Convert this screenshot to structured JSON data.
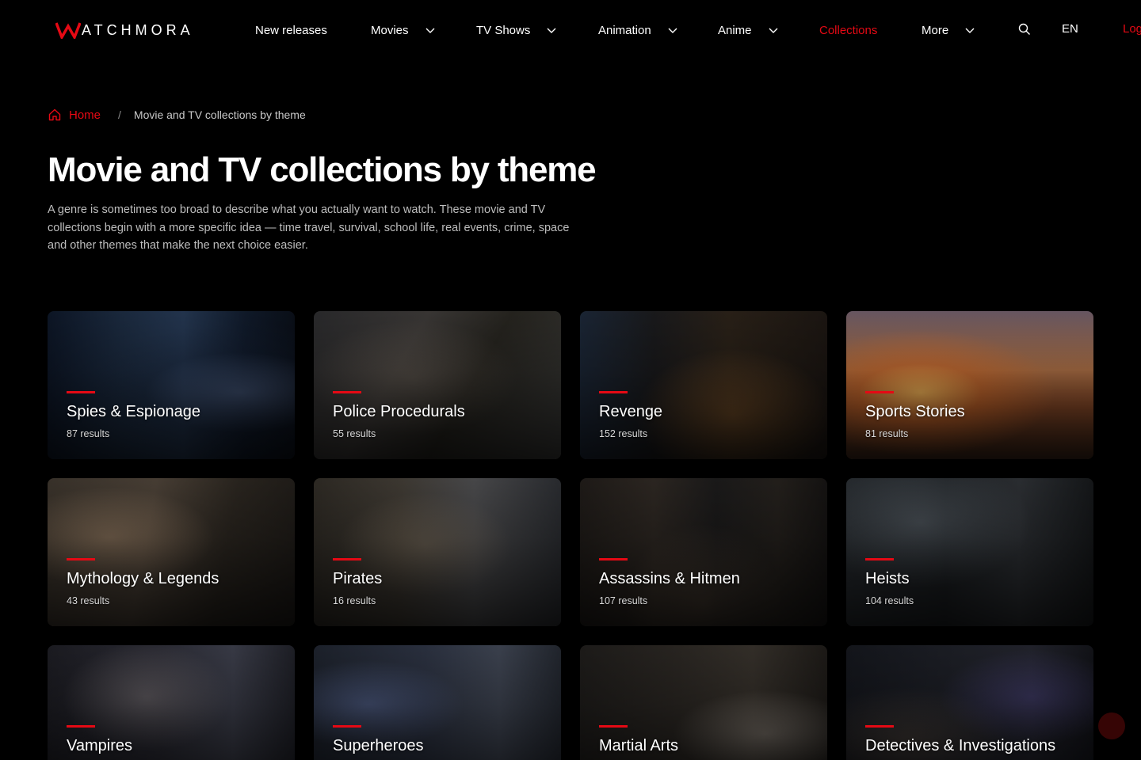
{
  "brand": {
    "name_initial": "W",
    "name_rest": "ATCHMORA",
    "accent": "#e50914"
  },
  "nav": {
    "items": [
      {
        "label": "New releases",
        "dropdown": false,
        "active": false
      },
      {
        "label": "Movies",
        "dropdown": true,
        "active": false
      },
      {
        "label": "TV Shows",
        "dropdown": true,
        "active": false
      },
      {
        "label": "Animation",
        "dropdown": true,
        "active": false
      },
      {
        "label": "Anime",
        "dropdown": true,
        "active": false
      },
      {
        "label": "Collections",
        "dropdown": false,
        "active": true
      },
      {
        "label": "More",
        "dropdown": true,
        "active": false
      }
    ],
    "search_icon": "search-icon",
    "language": "EN",
    "login_label": "Log"
  },
  "breadcrumb": {
    "home": "Home",
    "separator": "/",
    "current": "Movie and TV collections by theme"
  },
  "page": {
    "title": "Movie and TV collections by theme",
    "description": "A genre is sometimes too broad to describe what you actually want to watch. These movie and TV collections begin with a more specific idea — time travel, survival, school life, real events, crime, space and other themes that make the next choice easier."
  },
  "collections": [
    {
      "title": "Spies & Espionage",
      "count": "87 results"
    },
    {
      "title": "Police Procedurals",
      "count": "55 results"
    },
    {
      "title": "Revenge",
      "count": "152 results"
    },
    {
      "title": "Sports Stories",
      "count": "81 results"
    },
    {
      "title": "Mythology & Legends",
      "count": "43 results"
    },
    {
      "title": "Pirates",
      "count": "16 results"
    },
    {
      "title": "Assassins & Hitmen",
      "count": "107 results"
    },
    {
      "title": "Heists",
      "count": "104 results"
    },
    {
      "title": "Vampires",
      "count": ""
    },
    {
      "title": "Superheroes",
      "count": ""
    },
    {
      "title": "Martial Arts",
      "count": ""
    },
    {
      "title": "Detectives & Investigations",
      "count": ""
    }
  ]
}
